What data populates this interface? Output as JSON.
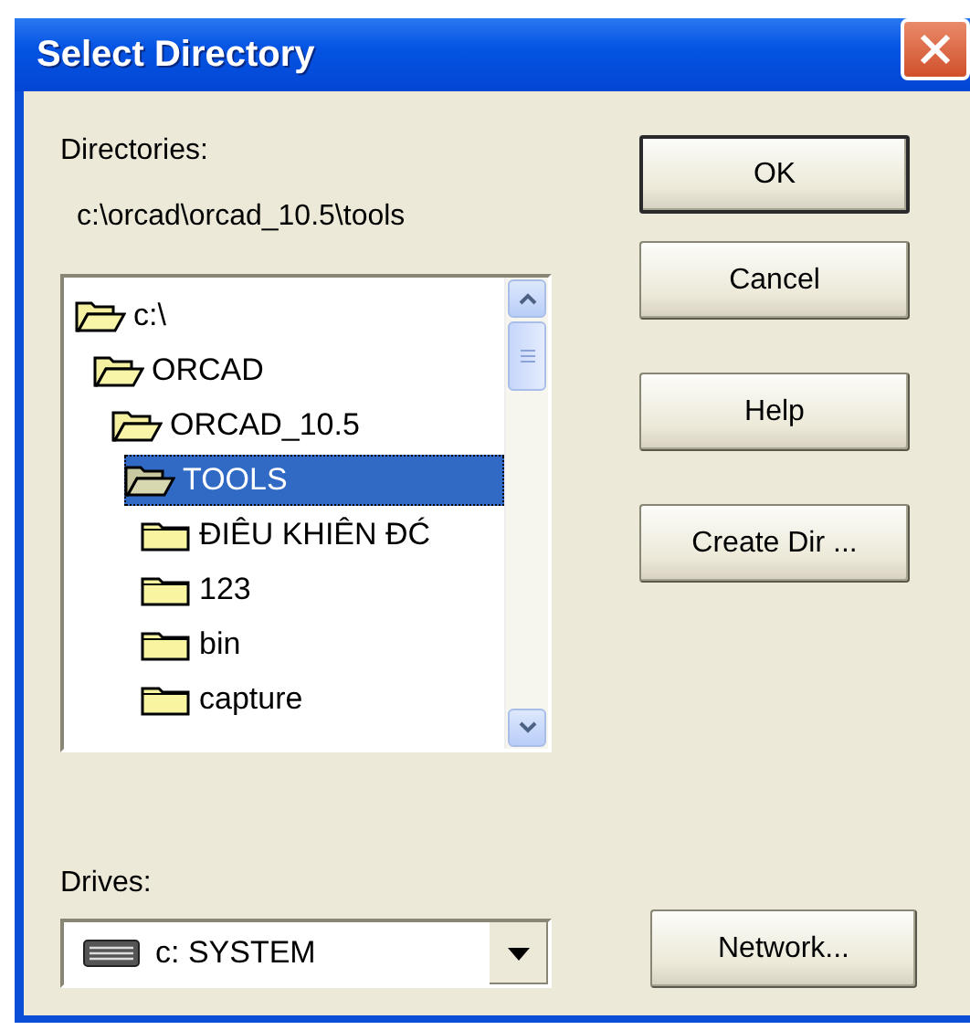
{
  "window": {
    "title": "Select Directory"
  },
  "directories": {
    "label": "Directories:",
    "path": "c:\\orcad\\orcad_10.5\\tools",
    "tree": [
      {
        "label": "c:\\",
        "expanded": true,
        "selected": false,
        "children": [
          {
            "label": "ORCAD",
            "expanded": true,
            "selected": false,
            "children": [
              {
                "label": "ORCAD_10.5",
                "expanded": true,
                "selected": false,
                "children": [
                  {
                    "label": "TOOLS",
                    "expanded": true,
                    "selected": true,
                    "children": [
                      {
                        "label": "ĐIÊU KHIÊN ĐĆ",
                        "expanded": false,
                        "selected": false
                      },
                      {
                        "label": "123",
                        "expanded": false,
                        "selected": false
                      },
                      {
                        "label": "bin",
                        "expanded": false,
                        "selected": false
                      },
                      {
                        "label": "capture",
                        "expanded": false,
                        "selected": false
                      }
                    ]
                  }
                ]
              }
            ]
          }
        ]
      }
    ]
  },
  "drives": {
    "label": "Drives:",
    "value": "c: SYSTEM"
  },
  "buttons": [
    {
      "label": "OK",
      "default": true
    },
    {
      "label": "Cancel",
      "default": false
    },
    {
      "label": "Help",
      "default": false
    },
    {
      "label": "Create Dir ...",
      "default": false
    }
  ],
  "network_button": {
    "label": "Network..."
  }
}
